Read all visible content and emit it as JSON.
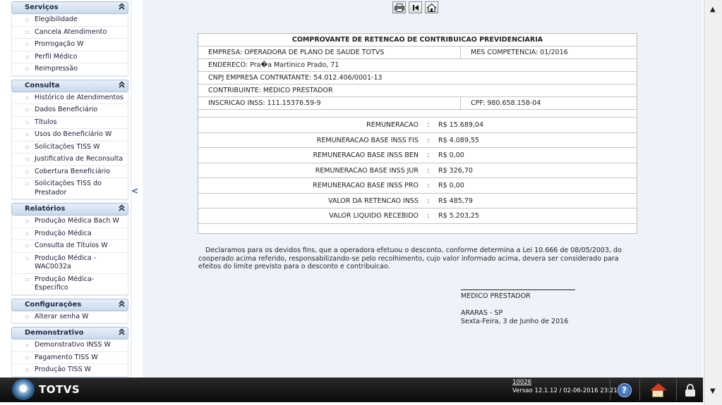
{
  "sidebar": {
    "collapse_glyph": "<",
    "sections": [
      {
        "title": "Serviços",
        "items": [
          "Elegibilidade",
          "Cancela Atendimento",
          "Prorrogação W",
          "Perfil Médico",
          "Reimpressão"
        ]
      },
      {
        "title": "Consulta",
        "items": [
          "Histórico de Atendimentos",
          "Dados Beneficiário",
          "Títulos",
          "Usos do Beneficiário W",
          "Solicitações TISS W",
          "Justificativa de Reconsulta",
          "Cobertura Beneficiário",
          "Solicitações TISS do Prestador"
        ]
      },
      {
        "title": "Relatórios",
        "items": [
          "Produção Médica Bach W",
          "Produção Médica",
          "Consulta de Títulos W",
          "Produção Médica - WAC0032a",
          "Produção Médica-Especifico"
        ]
      },
      {
        "title": "Configurações",
        "items": [
          "Alterar senha W"
        ]
      },
      {
        "title": "Demonstrativo",
        "items": [
          "Demonstrativo INSS W",
          "Pagamento TISS W",
          "Produção TISS W"
        ]
      }
    ]
  },
  "toolbar": {
    "icons": [
      "printer-icon",
      "first-page-icon",
      "home-icon"
    ]
  },
  "report": {
    "title": "COMPROVANTE DE RETENCAO DE CONTRIBUICAO PREVIDENCIARIA",
    "empresa": "EMPRESA: OPERADORA DE PLANO DE SAUDE TOTVS",
    "mes_competencia": "MES COMPETENCIA: 01/2016",
    "endereco": "ENDERECO: Pra�a Martinico Prado, 71",
    "cnpj": "CNPJ EMPRESA CONTRATANTE: 54.012.406/0001-13",
    "contribuinte": "CONTRIBUINTE: MEDICO PRESTADOR",
    "inscricao": "INSCRICAO INSS: 111.15376.59-9",
    "cpf": "CPF: 980.658.158-04",
    "colon": ":",
    "values": [
      {
        "label": "REMUNERACAO",
        "value": "R$ 15.689,04"
      },
      {
        "label": "REMUNERACAO BASE INSS FIS",
        "value": "R$ 4.089,55"
      },
      {
        "label": "REMUNERACAO BASE INSS BEN",
        "value": "R$ 0,00"
      },
      {
        "label": "REMUNERACAO BASE INSS JUR",
        "value": "R$ 326,70"
      },
      {
        "label": "REMUNERACAO BASE INSS PRO",
        "value": "R$ 0,00"
      },
      {
        "label": "VALOR DA RETENCAO INSS",
        "value": "R$ 485,79"
      },
      {
        "label": "VALOR LIQUIDO RECEBIDO",
        "value": "R$ 5.203,25"
      }
    ]
  },
  "declaration": "Declaramos para os devidos fins, que a operadora efetuou o desconto, conforme determina a Lei 10.666 de 08/05/2003, do cooperado acima referido, responsabilizando-se pelo recolhimento, cujo valor informado acima, devera ser considerado para efeitos do limite previsto para o desconto e contribuicao.",
  "signature": {
    "name": "MEDICO PRESTADOR",
    "city": "ARARAS - SP",
    "date": "Sexta-Feira, 3 de Junho de 2016"
  },
  "footer": {
    "logo_text": "TOTVS",
    "version_number": "10026",
    "version_text": "Versao 12.1.12 / 02-06-2016 23:21",
    "help_label": "?"
  },
  "scrollbar": {
    "up": "▲",
    "down": "▼"
  }
}
